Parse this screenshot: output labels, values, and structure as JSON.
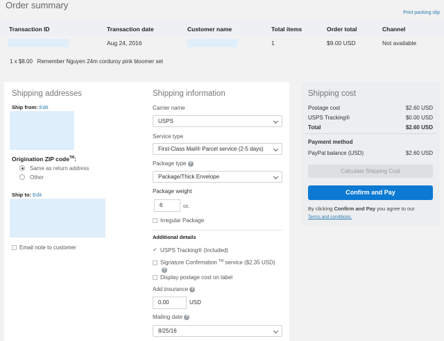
{
  "header": {
    "title": "Order summary",
    "print_link": "Print packing slip"
  },
  "transaction": {
    "columns": [
      "Transaction ID",
      "Transaction date",
      "Customer name",
      "Total items",
      "Order total",
      "Channel"
    ],
    "row": {
      "date": "Aug 24, 2016",
      "items": "1",
      "total": "$9.00 USD",
      "channel": "Not available"
    },
    "item_line": "1 x $8.00   Remember Nguyen 24m corduroy pink bloomer set"
  },
  "shipping_addresses": {
    "title": "Shipping addresses",
    "ship_from": "Ship from:",
    "edit": "Edit",
    "origin_zip": "Origination ZIP code",
    "tm": "TM",
    "origin_zip_colon": ":",
    "opt_same": "Same as return address",
    "opt_other": "Other",
    "ship_to": "Ship to:",
    "email_note": "Email note to customer"
  },
  "shipping_info": {
    "title": "Shipping information",
    "carrier_label": "Carrier name",
    "carrier_value": "USPS",
    "service_label": "Service type",
    "service_value": "First-Class Mail® Parcel service (2-5 days)",
    "package_label": "Package type",
    "package_value": "Package/Thick Envelope",
    "weight_label": "Package weight",
    "weight_value": "6",
    "weight_unit": "oz.",
    "irregular": "Irregular Package",
    "additional": "Additional details",
    "tracking": "USPS Tracking® (Included)",
    "signature": "Signature Confirmation",
    "signature_tm": "TM",
    "signature_rest": "service ($2.35 USD)",
    "display_cost": "Display postage cost on label",
    "insurance_label": "Add insurance",
    "insurance_value": "0.00",
    "insurance_unit": "USD",
    "mailing_label": "Mailing date",
    "mailing_value": "8/25/16"
  },
  "shipping_cost": {
    "title": "Shipping cost",
    "rows": [
      {
        "label": "Postage cost",
        "value": "$2.60 USD"
      },
      {
        "label": "USPS Tracking®",
        "value": "$0.00 USD"
      }
    ],
    "total_label": "Total",
    "total_value": "$2.60 USD",
    "payment_title": "Payment method",
    "payment_label": "PayPal balance (USD)",
    "payment_value": "$2.60 USD",
    "calc_button": "Calculate Shipping Cost",
    "confirm_button": "Confirm and Pay",
    "agree_pre": "By clicking ",
    "agree_bold": "Confirm and Pay",
    "agree_post": " you agree to our",
    "terms": "Terms and conditions."
  }
}
